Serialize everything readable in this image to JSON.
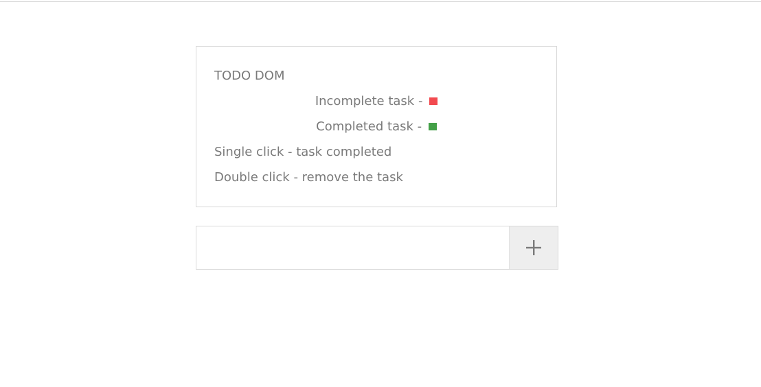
{
  "card": {
    "title": "TODO DOM",
    "legend": [
      {
        "label": "Incomplete task -",
        "color": "#f24a4f"
      },
      {
        "label": "Completed task -",
        "color": "#43a047"
      }
    ],
    "instructions": [
      "Single click - task completed",
      "Double click - remove the task"
    ]
  },
  "task_input": {
    "value": "",
    "placeholder": ""
  },
  "add_button": {
    "icon": "plus-icon",
    "color": "#7a7a7a"
  }
}
